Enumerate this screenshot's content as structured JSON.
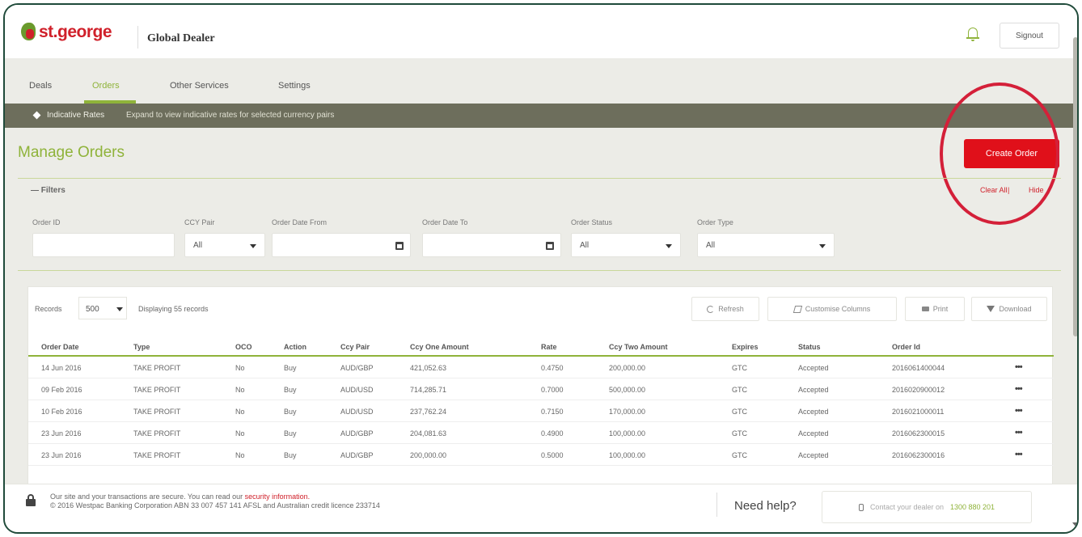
{
  "brand": {
    "logo_text": "st.george",
    "app_name": "Global Dealer"
  },
  "header": {
    "signout_label": "Signout"
  },
  "nav": {
    "items": [
      {
        "label": "Deals"
      },
      {
        "label": "Orders"
      },
      {
        "label": "Other Services"
      },
      {
        "label": "Settings"
      }
    ],
    "active": "Orders"
  },
  "banner": {
    "label": "Indicative Rates",
    "text": "Expand to view indicative rates for selected currency pairs"
  },
  "page": {
    "title": "Manage Orders",
    "create_button": "Create Order"
  },
  "filters": {
    "toggle_label": "Filters",
    "clear_all": "Clear All",
    "separator": "|",
    "hide": "Hide",
    "fields": {
      "order_id": {
        "label": "Order ID",
        "value": ""
      },
      "ccy_pair": {
        "label": "CCY Pair",
        "value": "All"
      },
      "date_from": {
        "label": "Order Date From",
        "value": ""
      },
      "date_to": {
        "label": "Order Date To",
        "value": ""
      },
      "status": {
        "label": "Order Status",
        "value": "All"
      },
      "type": {
        "label": "Order Type",
        "value": "All"
      }
    }
  },
  "table_toolbar": {
    "records_label": "Records",
    "records_value": "500",
    "displaying": "Displaying 55 records",
    "refresh": "Refresh",
    "customise": "Customise Columns",
    "print": "Print",
    "download": "Download"
  },
  "table": {
    "columns": [
      "Order Date",
      "Type",
      "OCO",
      "Action",
      "Ccy Pair",
      "Ccy One Amount",
      "Rate",
      "Ccy Two Amount",
      "Expires",
      "Status",
      "Order Id"
    ],
    "rows": [
      [
        "14 Jun 2016",
        "TAKE PROFIT",
        "No",
        "Buy",
        "AUD/GBP",
        "421,052.63",
        "0.4750",
        "200,000.00",
        "GTC",
        "Accepted",
        "2016061400044"
      ],
      [
        "09 Feb 2016",
        "TAKE PROFIT",
        "No",
        "Buy",
        "AUD/USD",
        "714,285.71",
        "0.7000",
        "500,000.00",
        "GTC",
        "Accepted",
        "2016020900012"
      ],
      [
        "10 Feb 2016",
        "TAKE PROFIT",
        "No",
        "Buy",
        "AUD/USD",
        "237,762.24",
        "0.7150",
        "170,000.00",
        "GTC",
        "Accepted",
        "2016021000011"
      ],
      [
        "23 Jun 2016",
        "TAKE PROFIT",
        "No",
        "Buy",
        "AUD/GBP",
        "204,081.63",
        "0.4900",
        "100,000.00",
        "GTC",
        "Accepted",
        "2016062300015"
      ],
      [
        "23 Jun 2016",
        "TAKE PROFIT",
        "No",
        "Buy",
        "AUD/GBP",
        "200,000.00",
        "0.5000",
        "100,000.00",
        "GTC",
        "Accepted",
        "2016062300016"
      ]
    ],
    "more_label": "•••"
  },
  "footer": {
    "line1": "Our site and your transactions are secure. You can read our",
    "link": "security information.",
    "line2": "© 2016 Westpac Banking Corporation ABN 33 007 457 141 AFSL and Australian credit licence 233714",
    "need_help": "Need help?",
    "contact_prefix": "Contact your dealer on",
    "contact_phone": "1300 880 201"
  }
}
